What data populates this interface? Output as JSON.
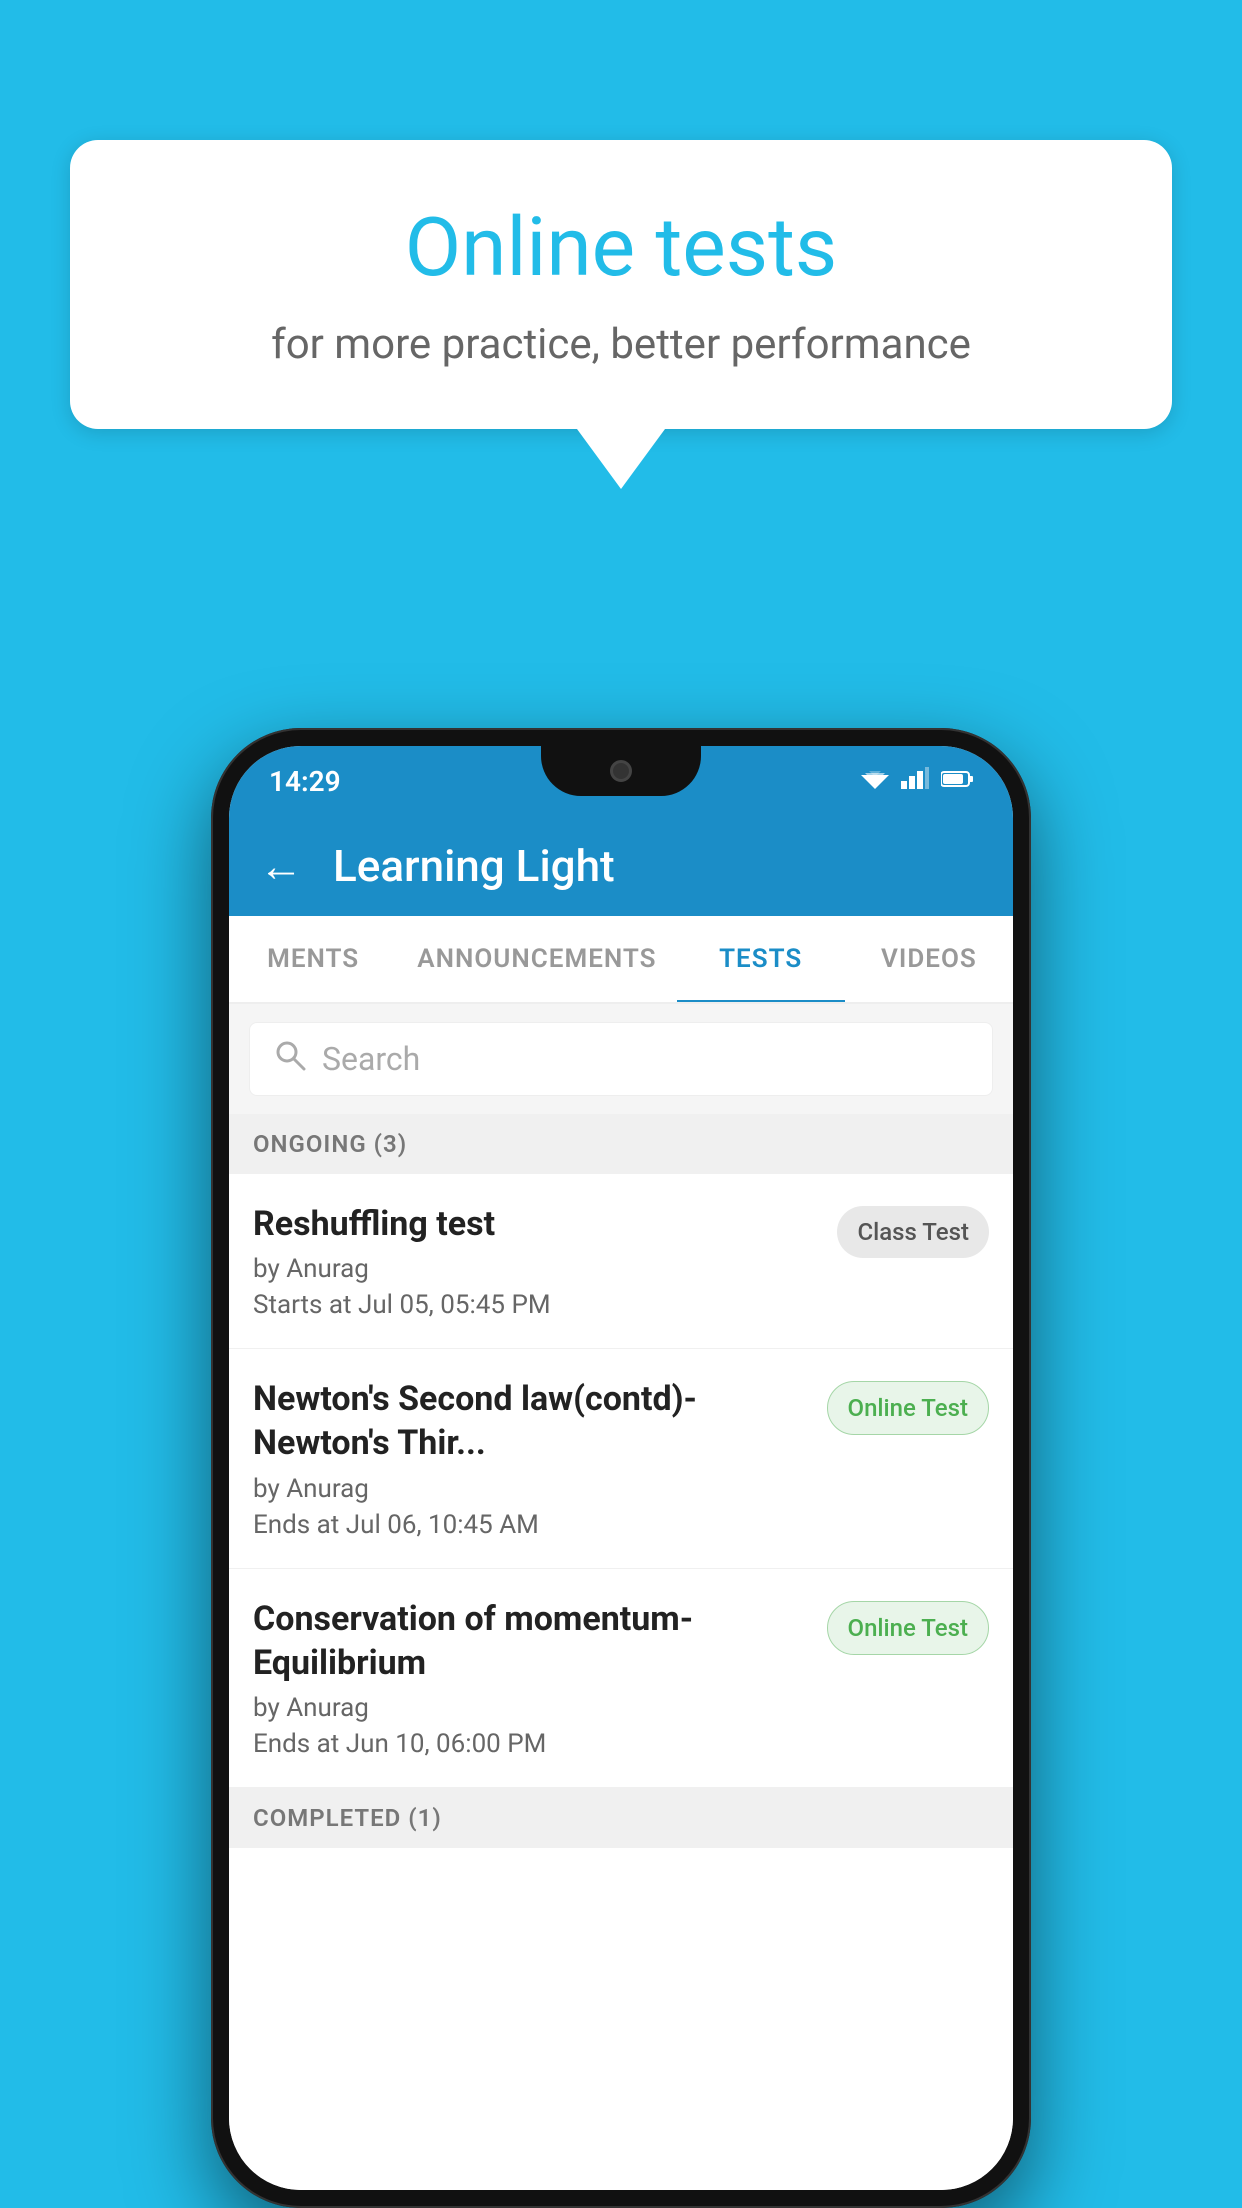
{
  "background": {
    "color": "#22bce8"
  },
  "speech_bubble": {
    "title": "Online tests",
    "subtitle": "for more practice, better performance"
  },
  "phone": {
    "status_bar": {
      "time": "14:29",
      "wifi": "▾",
      "signal": "▴",
      "battery": "▮"
    },
    "toolbar": {
      "back_label": "←",
      "title": "Learning Light"
    },
    "tabs": [
      {
        "label": "MENTS",
        "active": false
      },
      {
        "label": "ANNOUNCEMENTS",
        "active": false
      },
      {
        "label": "TESTS",
        "active": true
      },
      {
        "label": "VIDEOS",
        "active": false
      }
    ],
    "search": {
      "placeholder": "Search"
    },
    "ongoing_section": {
      "label": "ONGOING (3)"
    },
    "tests": [
      {
        "name": "Reshuffling test",
        "by": "by Anurag",
        "date": "Starts at  Jul 05, 05:45 PM",
        "badge": "Class Test",
        "badge_type": "class"
      },
      {
        "name": "Newton's Second law(contd)-Newton's Thir...",
        "by": "by Anurag",
        "date": "Ends at  Jul 06, 10:45 AM",
        "badge": "Online Test",
        "badge_type": "online"
      },
      {
        "name": "Conservation of momentum-Equilibrium",
        "by": "by Anurag",
        "date": "Ends at  Jun 10, 06:00 PM",
        "badge": "Online Test",
        "badge_type": "online"
      }
    ],
    "completed_section": {
      "label": "COMPLETED (1)"
    }
  }
}
